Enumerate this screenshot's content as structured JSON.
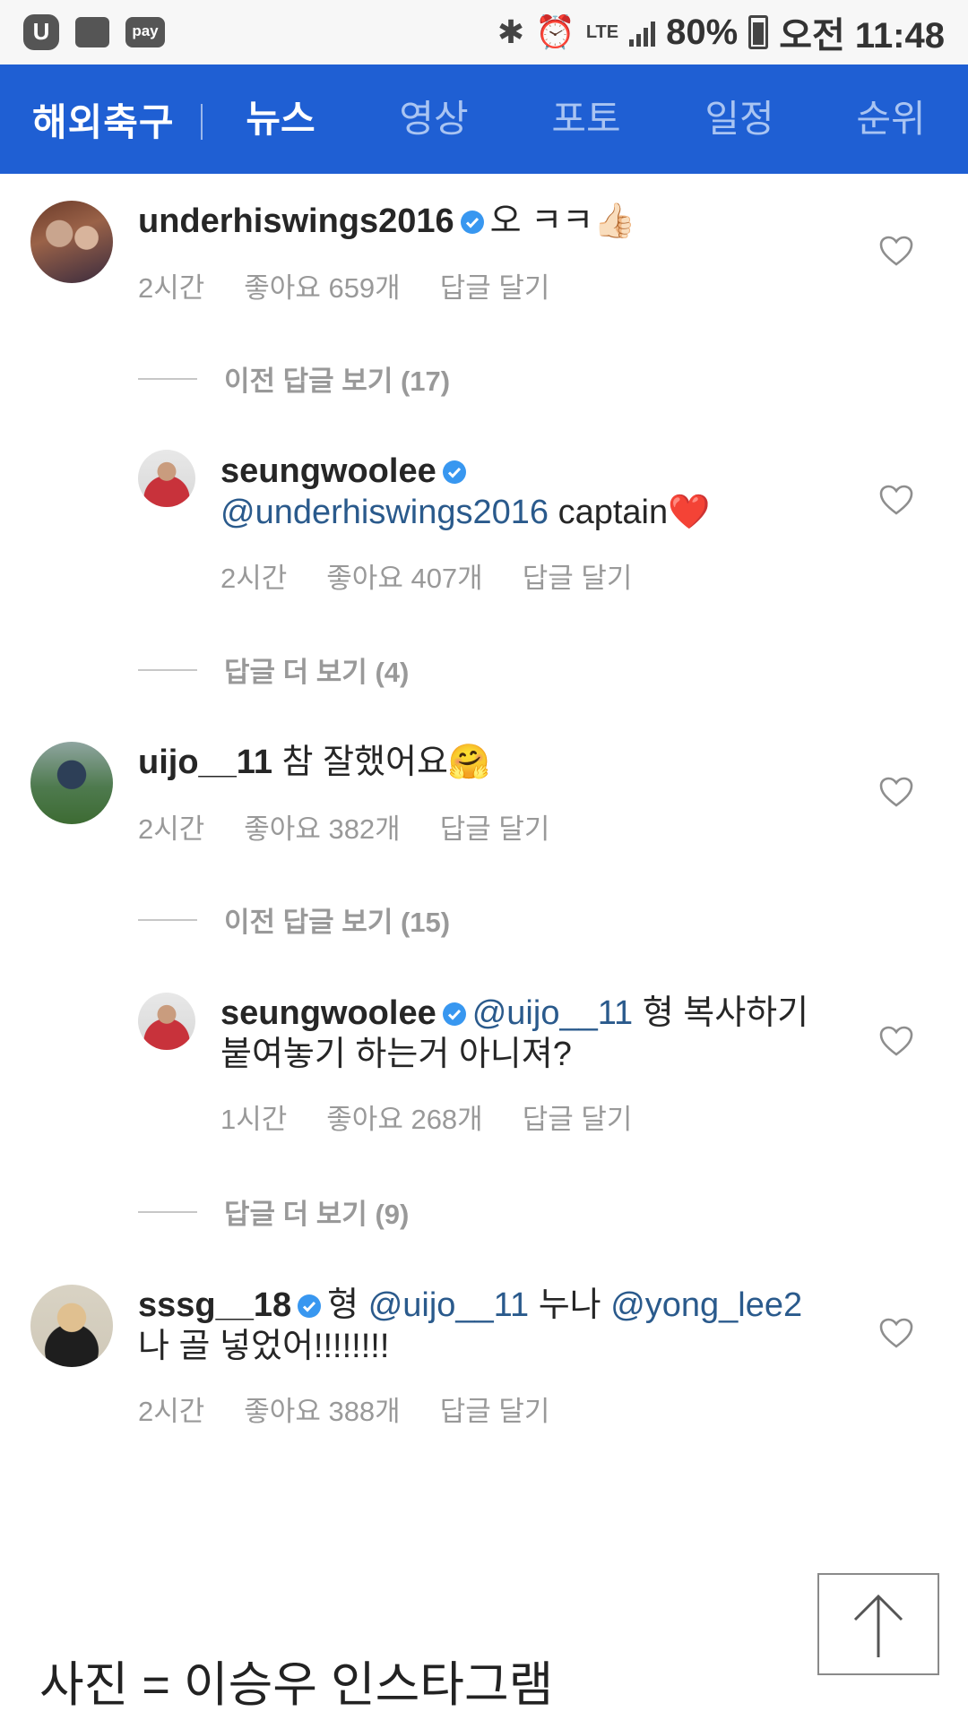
{
  "status_bar": {
    "battery": "80%",
    "time": "오전 11:48",
    "network": "LTE",
    "icons": [
      "u-plus-icon",
      "chat-icon",
      "pay-icon",
      "bluetooth-icon",
      "alarm-icon",
      "signal-icon",
      "battery-icon"
    ]
  },
  "nav": {
    "section_title": "해외축구",
    "tabs": [
      {
        "label": "뉴스",
        "active": true
      },
      {
        "label": "영상",
        "active": false
      },
      {
        "label": "포토",
        "active": false
      },
      {
        "label": "일정",
        "active": false
      },
      {
        "label": "순위",
        "active": false
      }
    ]
  },
  "comments": [
    {
      "username": "underhiswings2016",
      "verified": true,
      "text": "오 ㅋㅋ👍🏻",
      "time": "2시간",
      "likes": "좋아요 659개",
      "reply": "답글 달기"
    },
    {
      "view_previous": "이전 답글 보기 (17)"
    },
    {
      "username": "seungwoolee",
      "verified": true,
      "mention": "@underhiswings2016",
      "text": " captain❤️",
      "time": "2시간",
      "likes": "좋아요 407개",
      "reply": "답글 달기"
    },
    {
      "view_more": "답글 더 보기 (4)"
    },
    {
      "username": "uijo__11",
      "verified": false,
      "text": "참 잘했어요🤗",
      "time": "2시간",
      "likes": "좋아요 382개",
      "reply": "답글 달기"
    },
    {
      "view_previous": "이전 답글 보기 (15)"
    },
    {
      "username": "seungwoolee",
      "verified": true,
      "mention": "@uijo__11",
      "text_line1": " 형 복사하기",
      "text_line2": "붙여놓기 하는거 아니져?",
      "time": "1시간",
      "likes": "좋아요 268개",
      "reply": "답글 달기"
    },
    {
      "view_more": "답글 더 보기 (9)"
    },
    {
      "username": "sssg__18",
      "verified": true,
      "text_a": "형 ",
      "mention_a": "@uijo__11",
      "text_b": " 누나 ",
      "mention_b": "@yong_lee2",
      "text_line2": "나 골 넣었어!!!!!!!!",
      "time": "2시간",
      "likes": "좋아요 388개",
      "reply": "답글 달기"
    }
  ],
  "caption": "사진 = 이승우 인스타그램",
  "colors": {
    "nav_bg": "#1f5fd3",
    "nav_inactive": "#a9c4f2",
    "mention": "#2a5a8c",
    "meta": "#999999",
    "verified": "#3897f0"
  }
}
